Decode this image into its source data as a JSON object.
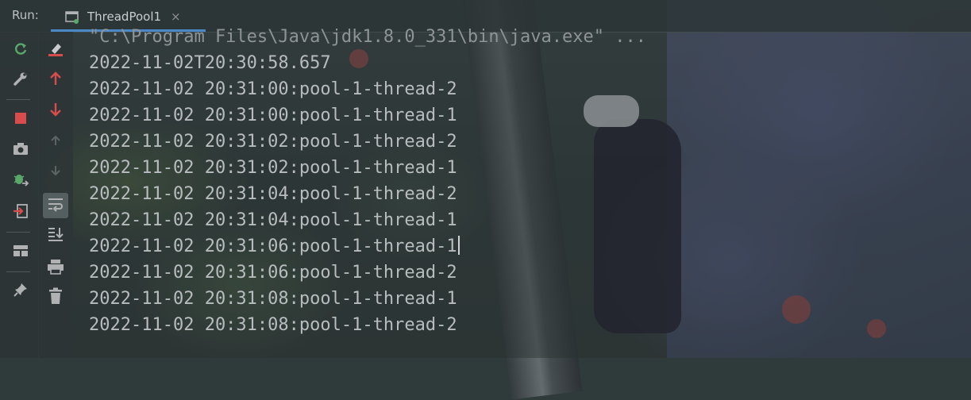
{
  "run_panel": {
    "label": "Run:",
    "tab": {
      "label": "ThreadPool1",
      "close": "×",
      "icon": "console-tab-icon"
    }
  },
  "toolbar_left": [
    {
      "name": "rerun-icon",
      "color": "#59a869"
    },
    {
      "name": "wrench-icon",
      "color": "#afb1b3"
    },
    {
      "name": "stop-icon",
      "color": "#d94c4c"
    },
    {
      "name": "camera-icon",
      "color": "#afb1b3"
    },
    {
      "name": "debug-settings-icon",
      "color": "#59a869"
    },
    {
      "name": "login-icon",
      "color": "#d94c4c"
    },
    {
      "name": "layout-icon",
      "color": "#afb1b3"
    },
    {
      "name": "pin-icon",
      "color": "#afb1b3"
    }
  ],
  "toolbar_right": [
    {
      "name": "clear-icon",
      "color": "#d94c4c"
    },
    {
      "name": "up-arrow-icon",
      "color": "#d94c4c"
    },
    {
      "name": "down-arrow-icon",
      "color": "#d94c4c"
    },
    {
      "name": "up-disabled-icon",
      "color": "#5e6466"
    },
    {
      "name": "down-disabled-icon",
      "color": "#5e6466"
    },
    {
      "name": "soft-wrap-icon",
      "color": "#afb1b3"
    },
    {
      "name": "scroll-to-end-icon",
      "color": "#afb1b3"
    },
    {
      "name": "print-icon",
      "color": "#afb1b3"
    },
    {
      "name": "trash-icon",
      "color": "#afb1b3"
    }
  ],
  "console": {
    "command": "\"C:\\Program Files\\Java\\jdk1.8.0_331\\bin\\java.exe\" ...",
    "lines": [
      "2022-11-02T20:30:58.657",
      "2022-11-02 20:31:00:pool-1-thread-2",
      "2022-11-02 20:31:00:pool-1-thread-1",
      "2022-11-02 20:31:02:pool-1-thread-2",
      "2022-11-02 20:31:02:pool-1-thread-1",
      "2022-11-02 20:31:04:pool-1-thread-2",
      "2022-11-02 20:31:04:pool-1-thread-1",
      "2022-11-02 20:31:06:pool-1-thread-1",
      "2022-11-02 20:31:06:pool-1-thread-2",
      "2022-11-02 20:31:08:pool-1-thread-1",
      "2022-11-02 20:31:08:pool-1-thread-2"
    ]
  }
}
